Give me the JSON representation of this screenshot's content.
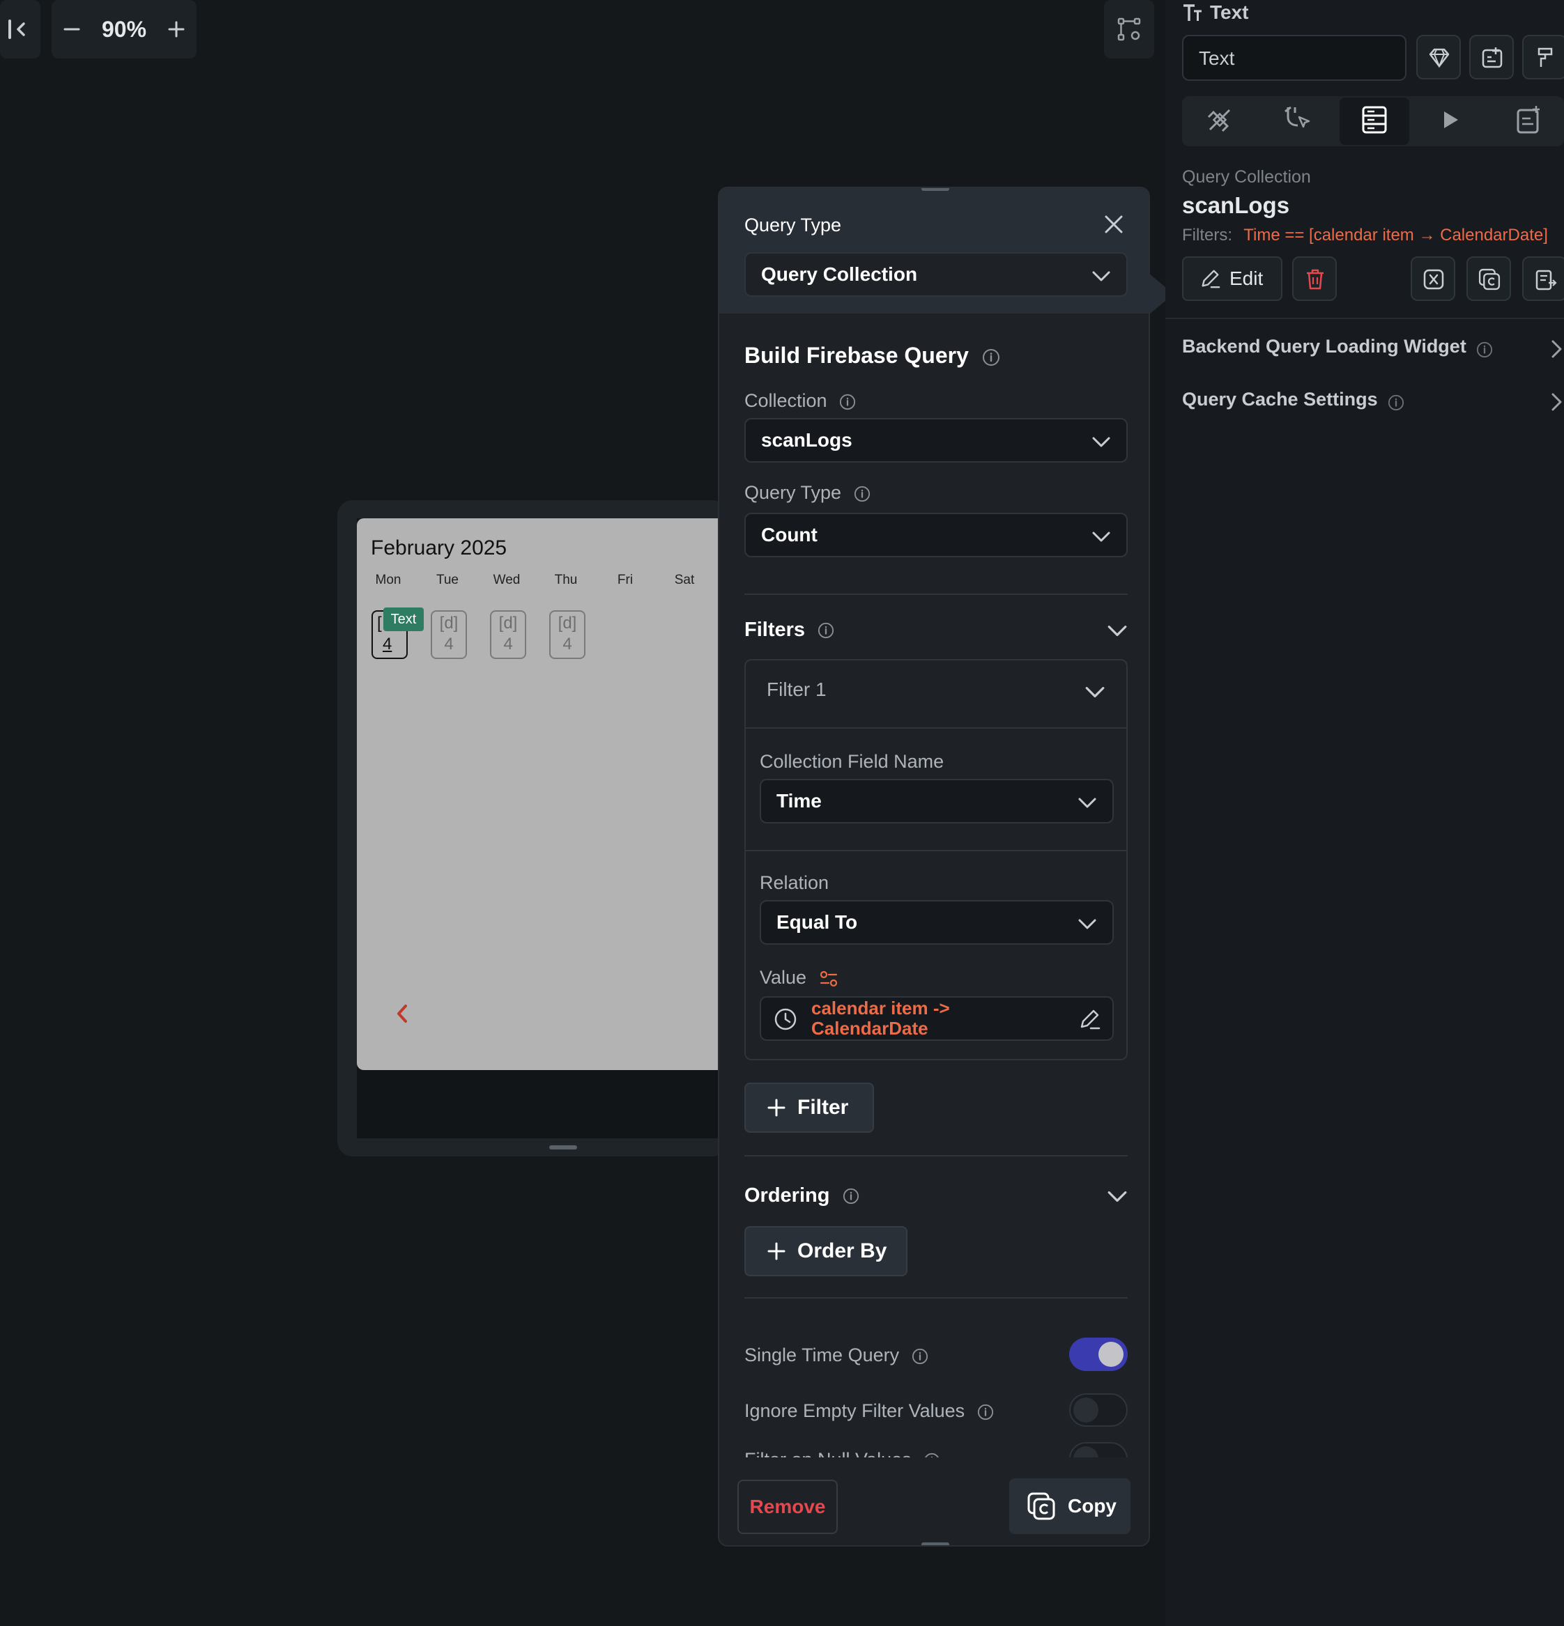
{
  "toolbar": {
    "zoom": "90%",
    "collapse_icon": "collapse-left-icon",
    "zoom_out_icon": "minus-icon",
    "zoom_in_icon": "plus-icon",
    "tree_icon": "widget-tree-icon"
  },
  "canvas": {
    "month_title": "February 2025",
    "weekdays": [
      "Mon",
      "Tue",
      "Wed",
      "Thu",
      "Fri",
      "Sat"
    ],
    "day_cells": [
      {
        "top": "[",
        "bottom": "4"
      },
      {
        "top": "[d]",
        "bottom": "4"
      },
      {
        "top": "[d]",
        "bottom": "4"
      },
      {
        "top": "[d]",
        "bottom": "4"
      }
    ],
    "selected_chip": "Text"
  },
  "query_modal": {
    "header_label": "Query Type",
    "query_type_value": "Query Collection",
    "build_title": "Build Firebase Query",
    "collection_label": "Collection",
    "collection_value": "scanLogs",
    "query_type_label": "Query Type",
    "query_type_select": "Count",
    "filters_label": "Filters",
    "filter_1_title": "Filter 1",
    "field_name_label": "Collection Field Name",
    "field_name_value": "Time",
    "relation_label": "Relation",
    "relation_value": "Equal To",
    "value_label": "Value",
    "value_line1": "calendar item ->",
    "value_line2": "CalendarDate",
    "add_filter_label": "Filter",
    "ordering_label": "Ordering",
    "order_by_label": "Order By",
    "single_time_label": "Single Time Query",
    "single_time_on": true,
    "ignore_empty_label": "Ignore Empty Filter Values",
    "ignore_empty_on": false,
    "filter_null_label": "Filter on Null Values",
    "remove_label": "Remove",
    "copy_label": "Copy"
  },
  "right_panel": {
    "widget_type": "Text",
    "widget_name": "Text",
    "tabs": [
      "properties-icon",
      "actions-icon",
      "backend-query-icon",
      "play-icon",
      "docs-icon"
    ],
    "active_tab": 2,
    "query_kind": "Query Collection",
    "collection": "scanLogs",
    "filters_prefix": "Filters:",
    "filters_text": "Time == [calendar item → CalendarDate]",
    "edit_label": "Edit",
    "loading_widget_label": "Backend Query Loading Widget",
    "cache_settings_label": "Query Cache Settings"
  },
  "colors": {
    "background": "#14181b",
    "panel": "#1e2227",
    "accent_orange": "#ee6b47",
    "danger": "#e5484d",
    "toggle_on": "#3b3bb0",
    "chip_green": "#2e7d62"
  }
}
